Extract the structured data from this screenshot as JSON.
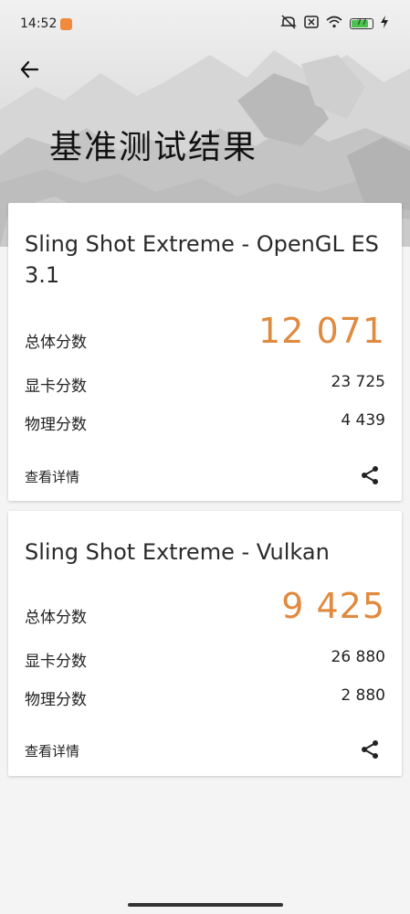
{
  "status_bar": {
    "time": "14:52",
    "battery": "77"
  },
  "header": {
    "title": "基准测试结果"
  },
  "cards": [
    {
      "title": "Sling Shot Extreme - OpenGL ES 3.1",
      "total_label": "总体分数",
      "total_value": "12 071",
      "graphics_label": "显卡分数",
      "graphics_value": "23 725",
      "physics_label": "物理分数",
      "physics_value": "4 439",
      "details_label": "查看详情"
    },
    {
      "title": "Sling Shot Extreme - Vulkan",
      "total_label": "总体分数",
      "total_value": "9 425",
      "graphics_label": "显卡分数",
      "graphics_value": "26 880",
      "physics_label": "物理分数",
      "physics_value": "2 880",
      "details_label": "查看详情"
    }
  ],
  "icons": {
    "back": "arrow-left-icon",
    "share": "share-icon",
    "mute": "mute-icon",
    "sim": "no-sim-icon",
    "wifi": "wifi-icon",
    "charging": "charging-icon"
  },
  "colors": {
    "accent": "#e08a3f",
    "background": "#f4f4f4",
    "card": "#ffffff"
  }
}
